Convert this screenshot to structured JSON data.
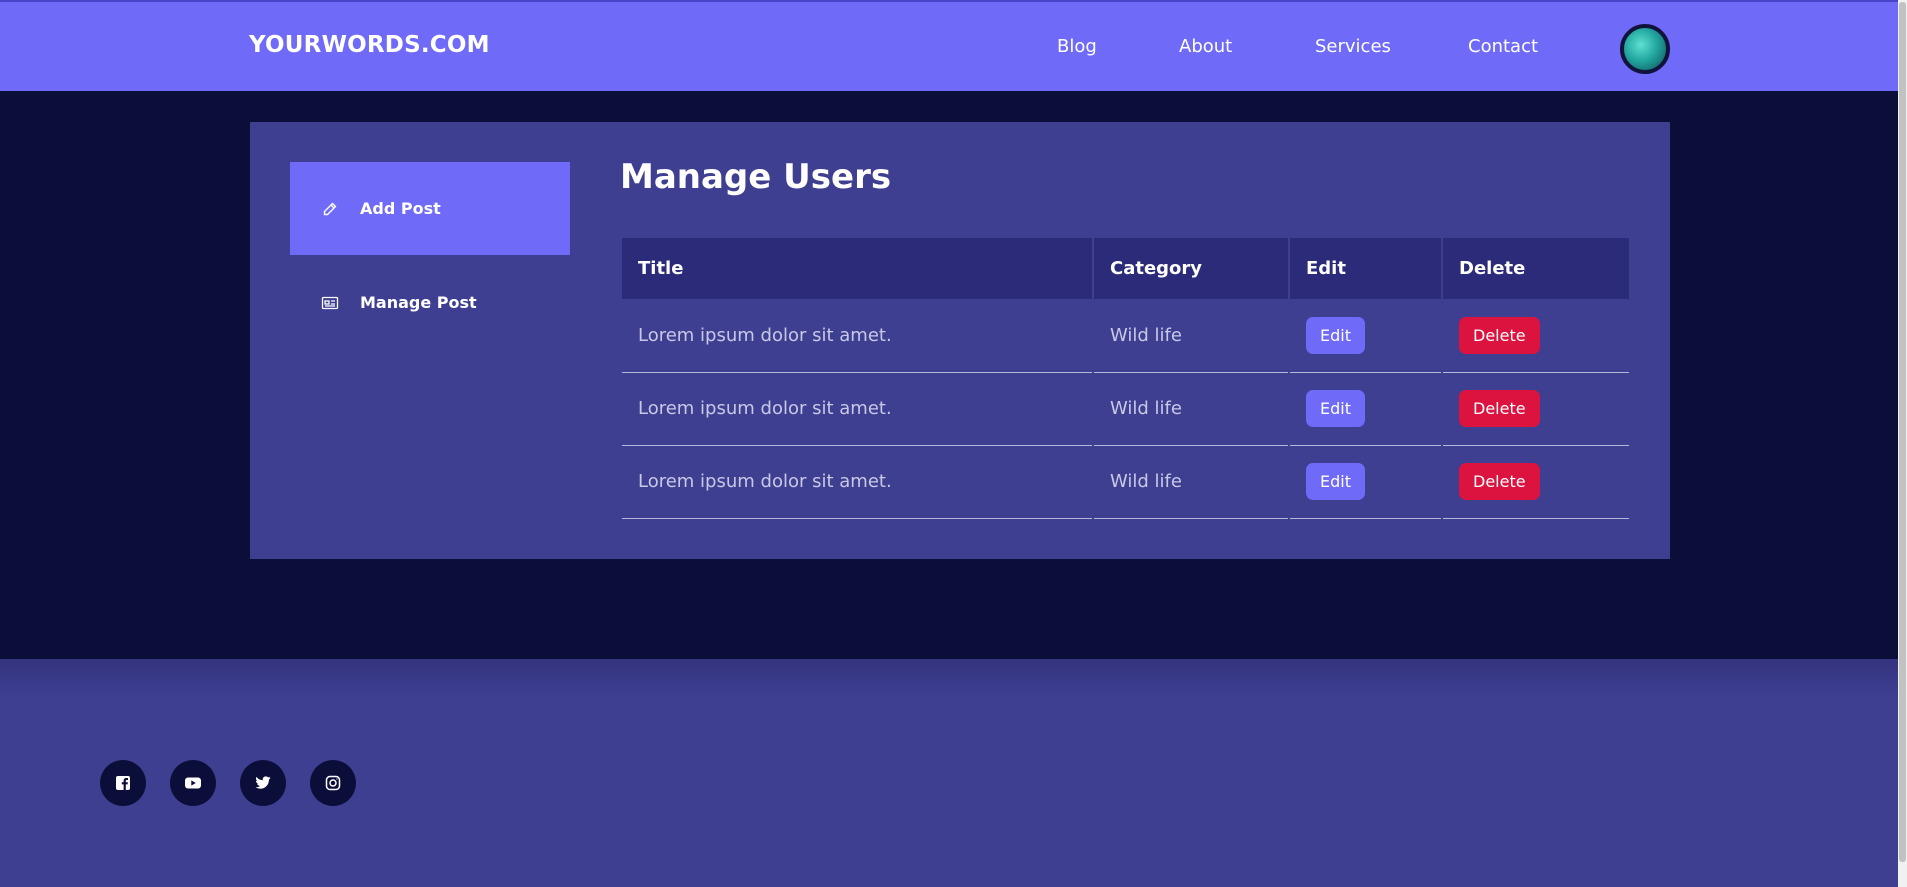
{
  "header": {
    "logo": "YOURWORDS.COM",
    "nav": [
      "Blog",
      "About",
      "Services",
      "Contact"
    ],
    "avatar_icon": "user-avatar"
  },
  "sidebar": {
    "items": [
      {
        "label": "Add Post",
        "icon": "pencil-icon",
        "active": true
      },
      {
        "label": "Manage Post",
        "icon": "post-card-icon",
        "active": false
      }
    ]
  },
  "main": {
    "title": "Manage Users",
    "table": {
      "headers": [
        "Title",
        "Category",
        "Edit",
        "Delete"
      ],
      "rows": [
        {
          "title": "Lorem ipsum dolor sit amet.",
          "category": "Wild life",
          "edit": "Edit",
          "delete": "Delete"
        },
        {
          "title": "Lorem ipsum dolor sit amet.",
          "category": "Wild life",
          "edit": "Edit",
          "delete": "Delete"
        },
        {
          "title": "Lorem ipsum dolor sit amet.",
          "category": "Wild life",
          "edit": "Edit",
          "delete": "Delete"
        }
      ]
    }
  },
  "footer": {
    "socials": [
      "facebook-icon",
      "youtube-icon",
      "twitter-icon",
      "instagram-icon"
    ]
  },
  "colors": {
    "primary": "#6f6af8",
    "background": "#0c0e3a",
    "panel": "#3f3f92",
    "table_header": "#2b2b7a",
    "danger": "#dc123f"
  }
}
